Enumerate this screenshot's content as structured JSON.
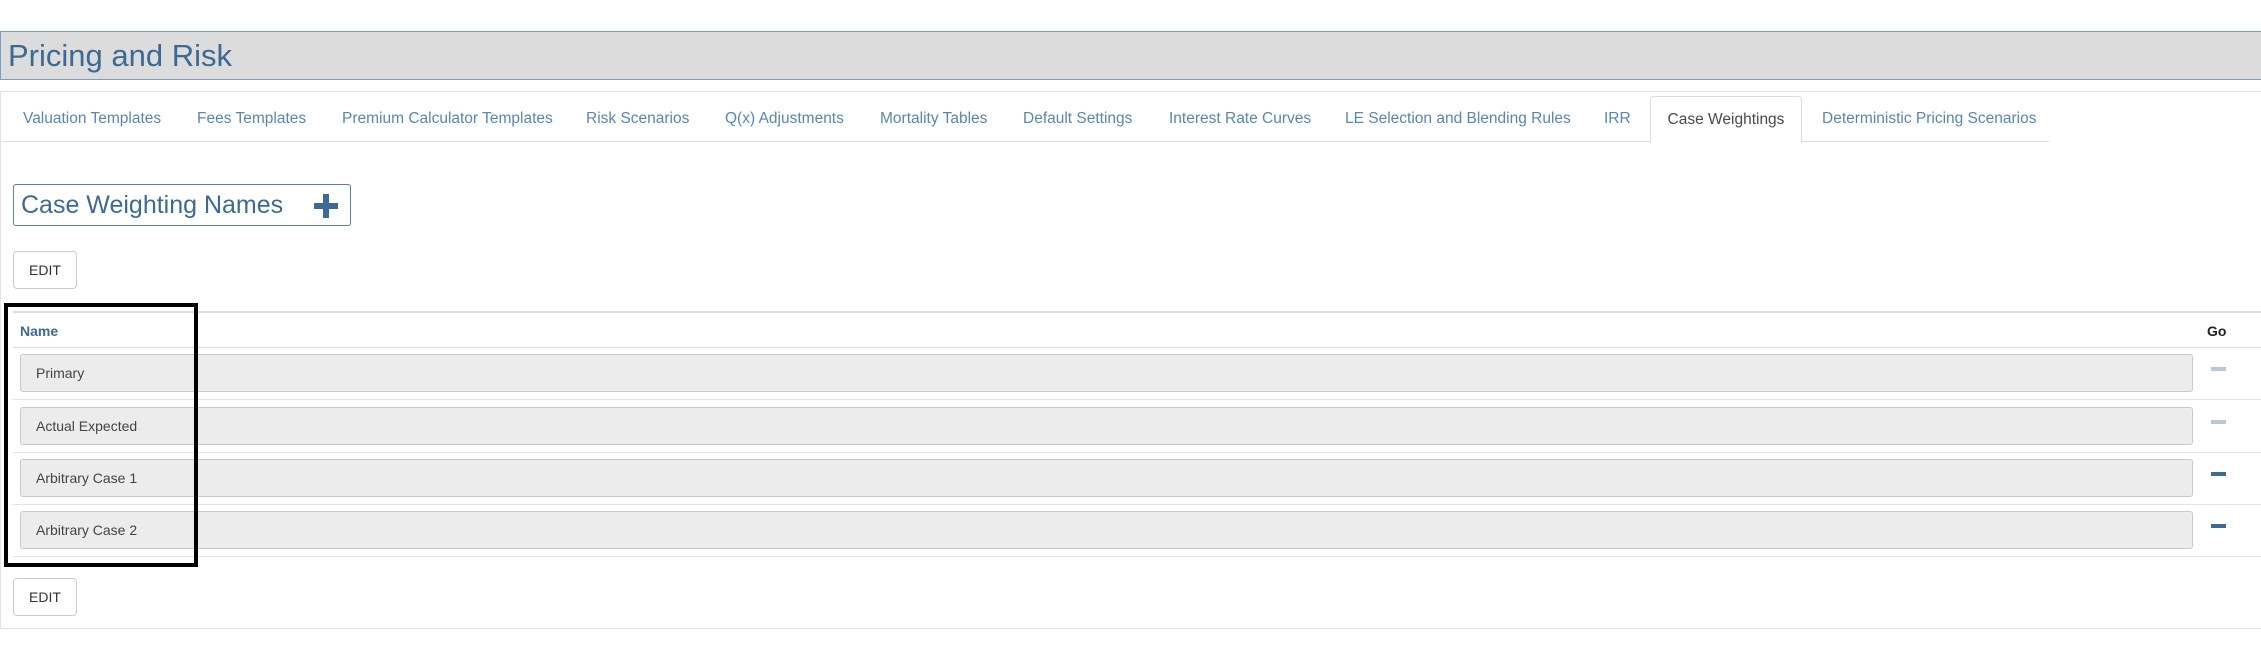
{
  "page": {
    "title": "Pricing and Risk"
  },
  "tabs": [
    {
      "label": "Valuation Templates",
      "active": false
    },
    {
      "label": "Fees Templates",
      "active": false
    },
    {
      "label": "Premium Calculator Templates",
      "active": false
    },
    {
      "label": "Risk Scenarios",
      "active": false
    },
    {
      "label": "Q(x) Adjustments",
      "active": false
    },
    {
      "label": "Mortality Tables",
      "active": false
    },
    {
      "label": "Default Settings",
      "active": false
    },
    {
      "label": "Interest Rate Curves",
      "active": false
    },
    {
      "label": "LE Selection and Blending Rules",
      "active": false
    },
    {
      "label": "IRR",
      "active": false
    },
    {
      "label": "Case Weightings",
      "active": true
    },
    {
      "label": "Deterministic Pricing Scenarios",
      "active": false
    }
  ],
  "section": {
    "title": "Case Weighting Names",
    "add_icon": "plus-icon"
  },
  "buttons": {
    "edit_top": "EDIT",
    "edit_bottom": "EDIT"
  },
  "table": {
    "columns": {
      "name": "Name",
      "go": "Go"
    },
    "rows": [
      {
        "name": "Primary",
        "remove_icon": "minus-icon",
        "enabled": false
      },
      {
        "name": "Actual Expected",
        "remove_icon": "minus-icon",
        "enabled": false
      },
      {
        "name": "Arbitrary Case 1",
        "remove_icon": "minus-icon",
        "enabled": true
      },
      {
        "name": "Arbitrary Case 2",
        "remove_icon": "minus-icon",
        "enabled": true
      }
    ]
  },
  "colors": {
    "accent": "#3d6a94",
    "tab_link": "#5b86b0",
    "title_bar": "#dcdcdc",
    "input_bg": "#ececec",
    "highlight": "#000000"
  }
}
